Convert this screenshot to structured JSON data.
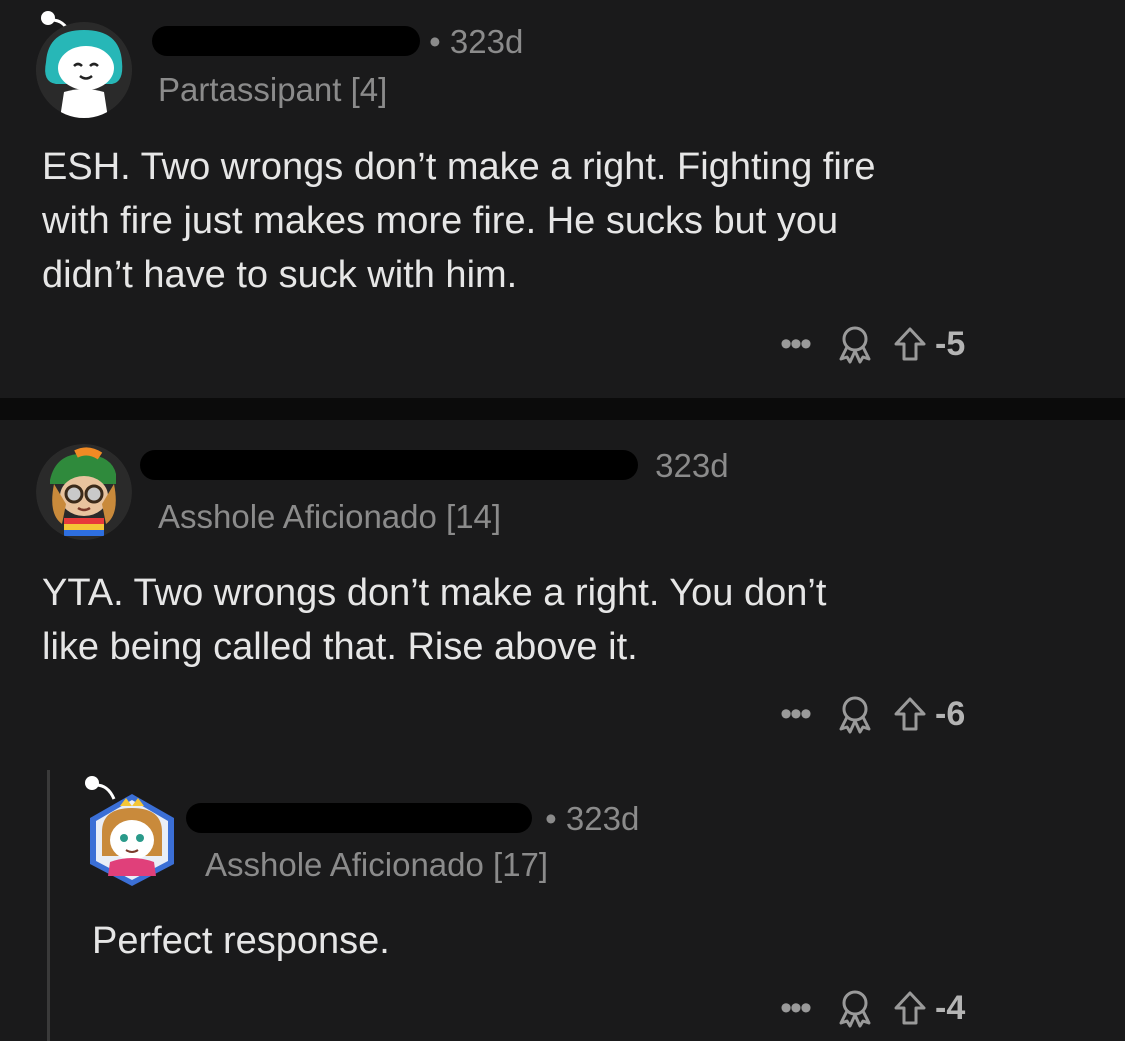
{
  "comments": [
    {
      "time": "• 323d",
      "flair": "Partassipant [4]",
      "body_lines": [
        "ESH. Two wrongs don’t make a right. Fighting fire",
        "with fire just makes more fire. He sucks but you",
        "didn’t have to suck with him."
      ],
      "more": "•••",
      "score": "-5"
    },
    {
      "time": "323d",
      "flair": "Asshole Aficionado [14]",
      "body_lines": [
        "YTA. Two wrongs don’t make a right. You don’t",
        "like being called that. Rise above it."
      ],
      "more": "•••",
      "score": "-6"
    },
    {
      "time": "• 323d",
      "flair": "Asshole Aficionado [17]",
      "body_lines": [
        "Perfect response."
      ],
      "more": "•••",
      "score": "-4"
    }
  ],
  "icons": {
    "award": "award-icon",
    "upvote": "upvote-arrow-icon",
    "more": "more-options-icon"
  },
  "colors": {
    "background": "#111111",
    "card": "#1a1a1b",
    "meta_text": "#8b8b8b",
    "body_text": "#e6e6e6",
    "redaction": "#000000"
  }
}
